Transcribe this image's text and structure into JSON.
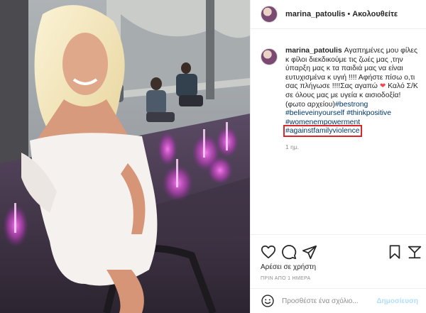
{
  "post": {
    "username": "marina_patoulis",
    "separator": "•",
    "follow_label": "Ακολουθείτε"
  },
  "caption": {
    "username": "marina_patoulis",
    "text_1": "Αγαπημένες μου φίλες κ φίλοι διεκδικούμε τις ζωές μας ,την ύπαρξη μας κ τα παιδιά μας να είναι ευτυχισμένα κ υγιή !!!! Αφήστε πίσω ο,τι σας πλήγωσε !!!!Σας αγαπώ",
    "heart": "❤",
    "text_2": "Καλό Σ/Κ σε όλους μας με υγεία κ αισιοδοξία!(φωτο αρχείου)",
    "tags": [
      "#bestrong",
      "#believeinyourself",
      "#thinkpositive",
      "#womenempowerment"
    ],
    "highlighted_tag": "#againstfamilyviolence",
    "time": "1 ημ."
  },
  "likes_text": "Αρέσει σε χρήστη",
  "posted_ago": "ΠΡΙΝ ΑΠΟ 1 ΗΜΕΡΑ",
  "comment": {
    "placeholder": "Προσθέστε ένα σχόλιο...",
    "post_label": "Δημοσίευση"
  },
  "icons": {
    "like": "heart-outline-icon",
    "comment": "speech-bubble-icon",
    "share": "paper-plane-icon",
    "save": "bookmark-icon",
    "emoji": "smiley-icon"
  },
  "colors": {
    "text": "#262626",
    "secondary": "#8e8e8e",
    "hashtag": "#00376b",
    "highlight_box": "#d9262b",
    "post_button_disabled": "#b2dffc",
    "fountain_light": "#d93fd6"
  }
}
